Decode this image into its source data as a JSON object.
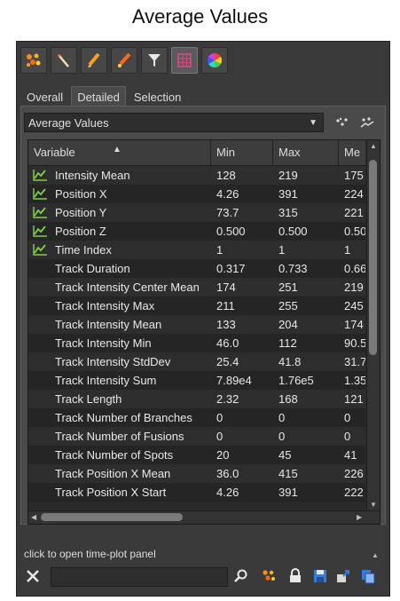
{
  "caption": "Average Values",
  "toolbar": {
    "icons": [
      "spots-icon",
      "wand-icon",
      "pencil-icon",
      "pen-icon",
      "filter-icon",
      "grid-icon",
      "color-wheel-icon"
    ]
  },
  "tabs": [
    {
      "label": "Overall",
      "active": false
    },
    {
      "label": "Detailed",
      "active": true
    },
    {
      "label": "Selection",
      "active": false
    }
  ],
  "combo": {
    "value": "Average Values"
  },
  "table": {
    "columns": [
      "Variable",
      "Min",
      "Max",
      "Me"
    ],
    "rows": [
      {
        "plot": true,
        "variable": "Intensity Mean",
        "min": "128",
        "max": "219",
        "mean": "175"
      },
      {
        "plot": true,
        "variable": "Position X",
        "min": "4.26",
        "max": "391",
        "mean": "224"
      },
      {
        "plot": true,
        "variable": "Position Y",
        "min": "73.7",
        "max": "315",
        "mean": "221"
      },
      {
        "plot": true,
        "variable": "Position Z",
        "min": "0.500",
        "max": "0.500",
        "mean": "0.50"
      },
      {
        "plot": true,
        "variable": "Time Index",
        "min": "1",
        "max": "1",
        "mean": "1"
      },
      {
        "plot": false,
        "variable": "Track Duration",
        "min": "0.317",
        "max": "0.733",
        "mean": "0.66"
      },
      {
        "plot": false,
        "variable": "Track Intensity Center Mean",
        "min": "174",
        "max": "251",
        "mean": "219"
      },
      {
        "plot": false,
        "variable": "Track Intensity Max",
        "min": "211",
        "max": "255",
        "mean": "245"
      },
      {
        "plot": false,
        "variable": "Track Intensity Mean",
        "min": "133",
        "max": "204",
        "mean": "174"
      },
      {
        "plot": false,
        "variable": "Track Intensity Min",
        "min": "46.0",
        "max": "112",
        "mean": "90.5"
      },
      {
        "plot": false,
        "variable": "Track Intensity StdDev",
        "min": "25.4",
        "max": "41.8",
        "mean": "31.7"
      },
      {
        "plot": false,
        "variable": "Track Intensity Sum",
        "min": "7.89e4",
        "max": "1.76e5",
        "mean": "1.35"
      },
      {
        "plot": false,
        "variable": "Track Length",
        "min": "2.32",
        "max": "168",
        "mean": "121"
      },
      {
        "plot": false,
        "variable": "Track Number of Branches",
        "min": "0",
        "max": "0",
        "mean": "0"
      },
      {
        "plot": false,
        "variable": "Track Number of Fusions",
        "min": "0",
        "max": "0",
        "mean": "0"
      },
      {
        "plot": false,
        "variable": "Track Number of Spots",
        "min": "20",
        "max": "45",
        "mean": "41"
      },
      {
        "plot": false,
        "variable": "Track Position X Mean",
        "min": "36.0",
        "max": "415",
        "mean": "226"
      },
      {
        "plot": false,
        "variable": "Track Position X Start",
        "min": "4.26",
        "max": "391",
        "mean": "222"
      }
    ]
  },
  "status": "click to open time-plot panel",
  "bottombar": {
    "icons": [
      "tools-icon",
      "search-icon",
      "spots-icon",
      "lock-icon",
      "save-icon",
      "export-icon",
      "copy-icon"
    ]
  },
  "colors": {
    "panel": "#3a3a3a",
    "table": "#2a2a2a",
    "plot_green": "#7ecf4a"
  }
}
